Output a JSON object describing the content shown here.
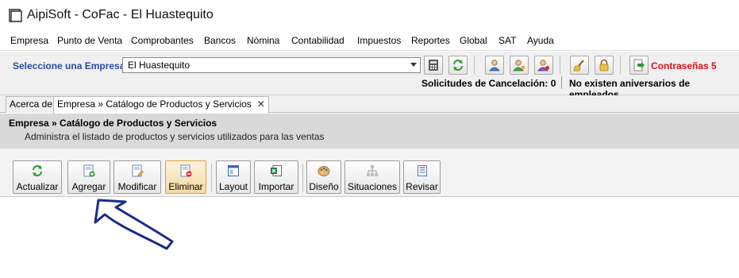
{
  "window": {
    "title": "AipiSoft - CoFac - El Huastequito"
  },
  "menu": [
    "Empresa",
    "Punto de Venta",
    "Comprobantes",
    "Bancos",
    "Nómina",
    "Contabilidad",
    "Impuestos",
    "Reportes",
    "Global",
    "SAT",
    "Ayuda"
  ],
  "company": {
    "label": "Seleccione una Empresa",
    "selected": "El Huastequito",
    "passwords_label": "Contraseñas 5",
    "cancel_requests": "Solicitudes de Cancelación: 0",
    "birthdays": "No existen aniversarios de empleados"
  },
  "tabs": [
    {
      "label": "Acerca de"
    },
    {
      "label": "Empresa » Catálogo de Productos y Servicios",
      "close": "✕"
    }
  ],
  "section": {
    "title": "Empresa » Catálogo de Productos y Servicios",
    "description": "Administra el listado de productos y servicios utilizados para las ventas"
  },
  "actions": [
    "Actualizar",
    "Agregar",
    "Modificar",
    "Eliminar",
    "Layout",
    "Importar",
    "Diseño",
    "Situaciones",
    "Revisar"
  ],
  "colors": {
    "accent_blue": "#2a4aa6",
    "password_red": "#e0101a",
    "arrow_blue": "#1a2a8c"
  }
}
